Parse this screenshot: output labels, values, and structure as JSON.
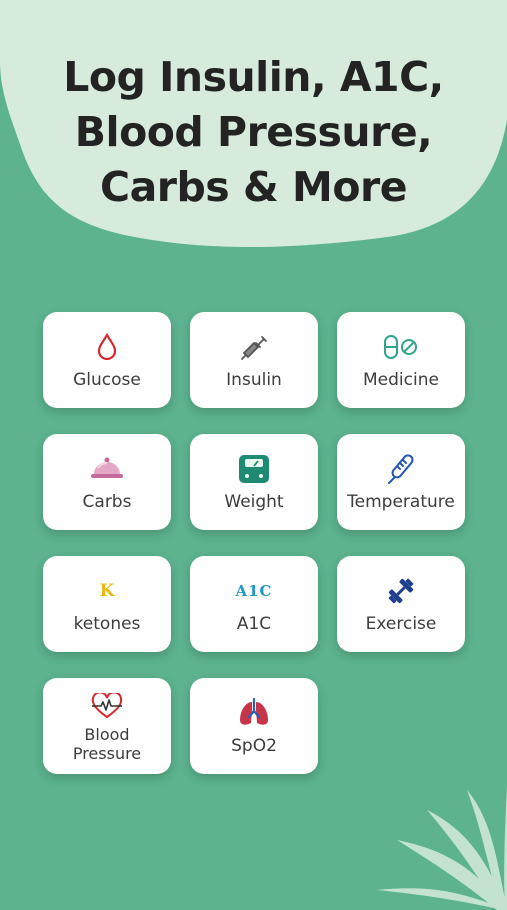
{
  "headline": {
    "line1": "Log Insulin, A1C,",
    "line2": "Blood Pressure,",
    "line3": "Carbs & More"
  },
  "colors": {
    "background": "#5cb38e",
    "blob": "#d7ebdd",
    "card": "#ffffff",
    "text": "#3d3d3d"
  },
  "cards": [
    {
      "label": "Glucose",
      "icon": "blood-drop-icon"
    },
    {
      "label": "Insulin",
      "icon": "syringe-icon"
    },
    {
      "label": "Medicine",
      "icon": "pill-icon"
    },
    {
      "label": "Carbs",
      "icon": "food-cloche-icon"
    },
    {
      "label": "Weight",
      "icon": "scale-icon"
    },
    {
      "label": "Temperature",
      "icon": "thermometer-icon"
    },
    {
      "label": "ketones",
      "icon": "k-letter-icon",
      "icon_text": "K"
    },
    {
      "label": "A1C",
      "icon": "a1c-text-icon",
      "icon_text": "A1C"
    },
    {
      "label": "Exercise",
      "icon": "dumbbell-icon"
    },
    {
      "label_line1": "Blood",
      "label_line2": "Pressure",
      "icon": "heart-pulse-icon"
    },
    {
      "label": "SpO2",
      "icon": "lungs-icon"
    }
  ]
}
